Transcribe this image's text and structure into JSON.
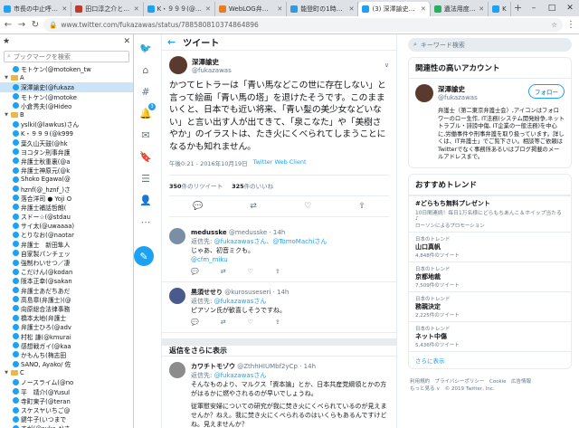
{
  "tabs": [
    {
      "title": "市長の中止呼びかけ",
      "active": false
    },
    {
      "title": "田口淳之介と小嶺麗",
      "active": false
    },
    {
      "title": "K・９９９(@k999",
      "active": false
    },
    {
      "title": "WebLOG弁護士中村",
      "active": false
    },
    {
      "title": "能登町の1時間天気",
      "active": false
    },
    {
      "title": "(3) 深澤諭史さんはT",
      "active": true
    },
    {
      "title": "遺法用度で無罪になる",
      "active": false
    },
    {
      "title": "K・",
      "active": false
    }
  ],
  "address": {
    "url": "www.twitter.com/fukazawas/status/788580810374864896"
  },
  "sidebar": {
    "search_placeholder": "ブックマークを検索",
    "items": [
      {
        "indent": 1,
        "type": "tw",
        "label": "モトケン(@motoken_tw",
        "selected": false
      },
      {
        "indent": 0,
        "type": "folder",
        "label": "A",
        "selected": false
      },
      {
        "indent": 1,
        "type": "tw",
        "label": "深澤諭史(@fukaza",
        "selected": true
      },
      {
        "indent": 1,
        "type": "tw",
        "label": "モトケン(@motoke",
        "selected": false
      },
      {
        "indent": 1,
        "type": "tw",
        "label": "小倉秀夫(@Hideo",
        "selected": false
      },
      {
        "indent": 0,
        "type": "folder",
        "label": "B",
        "selected": false
      },
      {
        "indent": 1,
        "type": "tw",
        "label": "yslki(@lawkus)さん",
        "selected": false
      },
      {
        "indent": 1,
        "type": "tw",
        "label": "K・９９９(@k999",
        "selected": false
      },
      {
        "indent": 1,
        "type": "tw",
        "label": "葉久山天鼓(@hk",
        "selected": false
      },
      {
        "indent": 1,
        "type": "tw",
        "label": "ヨコタン刑事弁護",
        "selected": false
      },
      {
        "indent": 1,
        "type": "tw",
        "label": "弁護士秋重裏(@a",
        "selected": false
      },
      {
        "indent": 1,
        "type": "tw",
        "label": "弁護士神原元(@k",
        "selected": false
      },
      {
        "indent": 1,
        "type": "tw",
        "label": "Shoko Egawa(@",
        "selected": false
      },
      {
        "indent": 1,
        "type": "tw",
        "label": "hznf(@_hznf_)さ",
        "selected": false
      },
      {
        "indent": 1,
        "type": "tw",
        "label": "落合洋司 ● Yoji O",
        "selected": false
      },
      {
        "indent": 1,
        "type": "tw",
        "label": "弁護士補話哲朗(",
        "selected": false
      },
      {
        "indent": 1,
        "type": "tw",
        "label": "スドー☆(@stdau",
        "selected": false
      },
      {
        "indent": 1,
        "type": "tw",
        "label": "サイ太(@uwaaaa)",
        "selected": false
      },
      {
        "indent": 1,
        "type": "tw",
        "label": "とりなお(@naotar",
        "selected": false
      },
      {
        "indent": 1,
        "type": "tw",
        "label": "弁護士　新田隼人",
        "selected": false
      },
      {
        "indent": 1,
        "type": "tw",
        "label": "自家製パンチェッ",
        "selected": false
      },
      {
        "indent": 1,
        "type": "tw",
        "label": "強制わいせつ／凄",
        "selected": false
      },
      {
        "indent": 1,
        "type": "tw",
        "label": "こだけん(@kodan",
        "selected": false
      },
      {
        "indent": 1,
        "type": "tw",
        "label": "阪本正幸(@sakan",
        "selected": false
      },
      {
        "indent": 1,
        "type": "tw",
        "label": "弁護士あだちあだ",
        "selected": false
      },
      {
        "indent": 1,
        "type": "tw",
        "label": "高島章(弁護士)(@",
        "selected": false
      },
      {
        "indent": 1,
        "type": "tw",
        "label": "向原総合法律事務",
        "selected": false
      },
      {
        "indent": 1,
        "type": "tw",
        "label": "橋本太地(弁護士",
        "selected": false
      },
      {
        "indent": 1,
        "type": "tw",
        "label": "弁護士ひろ(@adv",
        "selected": false
      },
      {
        "indent": 1,
        "type": "tw",
        "label": "村松 謙(@kmurai",
        "selected": false
      },
      {
        "indent": 1,
        "type": "tw",
        "label": "感想戦ガイ(@kaa",
        "selected": false
      },
      {
        "indent": 1,
        "type": "tw",
        "label": "かもんち(梅志田",
        "selected": false
      },
      {
        "indent": 1,
        "type": "tw",
        "label": "SANO, Ayako/ 佐",
        "selected": false
      },
      {
        "indent": 0,
        "type": "folder",
        "label": "C",
        "selected": false
      },
      {
        "indent": 1,
        "type": "tw",
        "label": "ノースライム(@no",
        "selected": false
      },
      {
        "indent": 1,
        "type": "tw",
        "label": "平　靖介(@Yusul",
        "selected": false
      },
      {
        "indent": 1,
        "type": "tw",
        "label": "寺町東子(@teran",
        "selected": false
      },
      {
        "indent": 1,
        "type": "tw",
        "label": "スケスヤいちご@",
        "selected": false
      },
      {
        "indent": 1,
        "type": "tw",
        "label": "鍵牛子(いつまで",
        "selected": false
      },
      {
        "indent": 1,
        "type": "tw",
        "label": "すが(@suka_t)さ",
        "selected": false
      },
      {
        "indent": 1,
        "type": "tw",
        "label": "ほりやちで(@nrv",
        "selected": false
      }
    ]
  },
  "nav": {
    "badge": "3"
  },
  "header": {
    "back": "←",
    "title": "ツイート"
  },
  "tweet": {
    "name": "深澤諭史",
    "handle": "@fukazawas",
    "text": "かつてヒトラーは「青い馬などこの世に存在しない」と言って絵画「青い馬の塔」を退けたそうです。このままいくと、日本でも近い将来、「青い髪の美少女などいない」と言い出す人が出てきて、「泉こなた」や「美樹さやか」のイラストは、たき火にくべられてしまうことになるかも知れません。",
    "time": "午後0:21 - 2016年10月19日",
    "client": "Twitter Web Client",
    "retweets_num": "350",
    "retweets_label": "件のリツイート",
    "likes_num": "325",
    "likes_label": "件のいいね"
  },
  "replies": [
    {
      "name": "medusske",
      "handle": "@medusske",
      "time": "· 14h",
      "to_prefix": "返信先:",
      "to_users": "@fukazawasさん、@TomoMachiさん",
      "text": "じゃあ、初音ミクも。",
      "link": "@cfm_miku",
      "avatar_color": "#7a8ea6"
    },
    {
      "name": "黒須せせり",
      "handle": "@kurosuseseri",
      "time": "· 14h",
      "to_prefix": "返信先:",
      "to_users": "@fukazawasさん",
      "text": "ピアソン氏が歓喜しそうですね。",
      "link": "",
      "avatar_color": "#4b5a8c"
    }
  ],
  "more_replies": "返信をさらに表示",
  "reply3": {
    "name": "カワチトモゾウ",
    "handle": "@ZthhHIUMbf2yCp",
    "time": "· 14h",
    "to_prefix": "返信先:",
    "to_users": "@fukazawasさん",
    "text1": "そんなものより、マルクス「資本論」とか、日本共産党綱領とかの方がはるかに燃やされるのが早いでしょうね。",
    "text2": "従軍慰安婦についての研究が我に焚き火にくべられているのが見えませんか？ねえ。我に焚き火にくべられるのはいくらもあるんですけどね。見えませんか？"
  },
  "right": {
    "search_placeholder": "キーワード検索",
    "related_title": "関連性の高いアカウント",
    "account": {
      "name": "深澤諭史",
      "handle": "@fukazawas",
      "follow": "フォロー",
      "bio": "弁護士（第二東京弁護士会）,アイコンはフォロワーのロー生作, IT法務(システム開発紛争,ネットトラブル・誹謗中傷, IT企業の一般法務)を中心に,労働事件や刑事弁護を取り扱っています。詳しくは、IT弁護士」でご覧下さい。相談等ご依頼はTwitterでなく事務所あるいはブログ掲載のメールアドレスまで。"
    },
    "trends_title": "おすすめトレンド",
    "trends": [
      {
        "loc": "",
        "name": "#どらもち無料プレゼント",
        "desc": "10日間連続！毎日1万名様にどらもちあんこ＆ホイップ当たる♪",
        "count": "",
        "promo": "ローソンによるプロモーション"
      },
      {
        "loc": "日本のトレンド",
        "name": "山口真帆",
        "desc": "",
        "count": "4,848件のツイート",
        "promo": ""
      },
      {
        "loc": "日本のトレンド",
        "name": "京都地裁",
        "desc": "",
        "count": "7,509件のツイート",
        "promo": ""
      },
      {
        "loc": "日本のトレンド",
        "name": "務親決定",
        "desc": "",
        "count": "2,225件のツイート",
        "promo": ""
      },
      {
        "loc": "日本のトレンド",
        "name": "ネット中傷",
        "desc": "",
        "count": "5,436件のツイート",
        "promo": ""
      }
    ],
    "more": "さらに表示",
    "footer": "利用規約　プライバシーポリシー　Cookie　広告情報\nもっと見る ∨　© 2019 Twitter, Inc."
  }
}
